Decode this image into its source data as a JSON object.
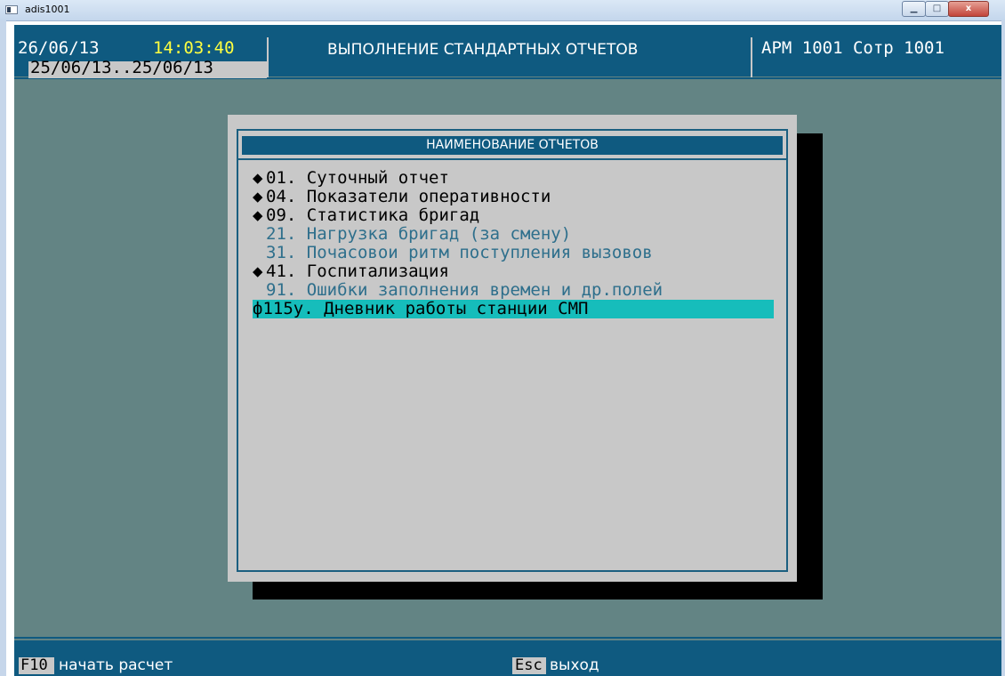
{
  "window": {
    "title": "adis1001",
    "controls": [
      "minimize",
      "maximize",
      "close"
    ],
    "close_glyph": "x"
  },
  "header": {
    "date": "26/06/13",
    "time": "14:03:40",
    "title": "ВЫПОЛНЕНИЕ СТАНДАРТНЫХ ОТЧЕТОВ",
    "workstation": "АРМ 1001 Сотр 1001",
    "date_range": "25/06/13..25/06/13"
  },
  "dialog": {
    "title": "НАИМЕНОВАНИЕ ОТЧЕТОВ",
    "items": [
      {
        "marker": "◆",
        "label": "01. Суточный отчет",
        "state": "active"
      },
      {
        "marker": "◆",
        "label": "04. Показатели оперативности",
        "state": "active"
      },
      {
        "marker": "◆",
        "label": "09. Статистика бригад",
        "state": "active"
      },
      {
        "marker": "",
        "label": "21. Нагрузка бригад (за смену)",
        "state": "inactive"
      },
      {
        "marker": "",
        "label": "31. Почасовои ритм поступления вызовов",
        "state": "inactive"
      },
      {
        "marker": "◆",
        "label": "41. Госпитализация",
        "state": "active"
      },
      {
        "marker": "",
        "label": "91. Ошибки заполнения времен и др.полей",
        "state": "inactive"
      },
      {
        "marker": "",
        "label": "ф115у. Дневник работы станции СМП",
        "state": "selected"
      }
    ]
  },
  "footer": {
    "f10_key": "F10",
    "f10_label": "начать расчет",
    "esc_key": "Esc",
    "esc_label": "выход"
  },
  "colors": {
    "console_bg": "#638484",
    "bar": "#0f5a80",
    "time": "#ffff40",
    "dialog_bg": "#c8c8c8",
    "inactive_item": "#2e6f8c",
    "selection": "#16bdbb",
    "shadow": "#000000"
  }
}
